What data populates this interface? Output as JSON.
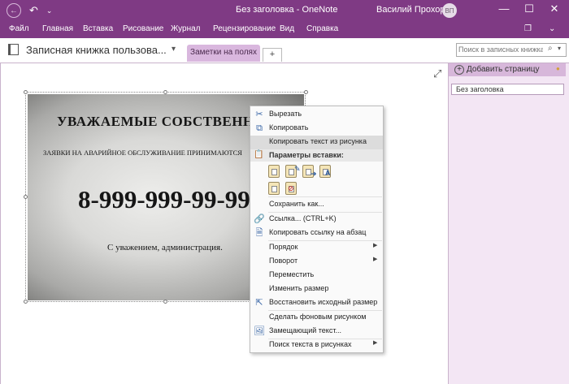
{
  "window": {
    "title": "Без заголовка  -  OneNote",
    "user": "Василий Прохоров",
    "avatar_initials": "ВП",
    "minimize_glyph": "—",
    "maximize_glyph": "☐",
    "close_glyph": "✕",
    "back_glyph": "←",
    "undo_glyph": "↶",
    "qat_glyph": "⌄"
  },
  "ribbon": {
    "tabs": [
      "Файл",
      "Главная",
      "Вставка",
      "Рисование",
      "Журнал",
      "Рецензирование",
      "Вид",
      "Справка"
    ]
  },
  "notebook": {
    "name": "Записная книжка пользова...",
    "caret": "▾",
    "section_tab": "Заметки на полях",
    "add_tab": "+"
  },
  "search": {
    "placeholder": "Поиск в записных книжках",
    "icon": "⌕",
    "caret": "▾"
  },
  "photo": {
    "line1": "УВАЖАЕМЫЕ СОБСТВЕННИКИ",
    "line2": "ЗАЯВКИ НА АВАРИЙНОЕ ОБСЛУЖИВАНИЕ ПРИНИМАЮТСЯ",
    "line3": "8-999-999-99-99",
    "line4": "С уважением, администрация."
  },
  "pages_pane": {
    "add_page_label": "Добавить страницу",
    "pages": [
      "Без заголовка"
    ]
  },
  "context_menu": {
    "cut": "Вырезать",
    "copy": "Копировать",
    "copy_text": "Копировать текст из рисунка",
    "paste_header": "Параметры вставки:",
    "save_as": "Сохранить как...",
    "link": "Ссылка...  (CTRL+K)",
    "copy_link": "Копировать ссылку на абзац",
    "order": "Порядок",
    "rotate": "Поворот",
    "move": "Переместить",
    "resize": "Изменить размер",
    "restore_size": "Восстановить исходный размер",
    "set_background": "Сделать фоновым рисунком",
    "alt_text": "Замещающий текст...",
    "search_text": "Поиск текста в рисунках",
    "submenu_arrow": "▶"
  },
  "colors": {
    "accent": "#7f3a84",
    "tab_active": "#d9b7de",
    "pane_bg": "#f3e6f4",
    "menu_highlight": "#dcdcdc"
  }
}
